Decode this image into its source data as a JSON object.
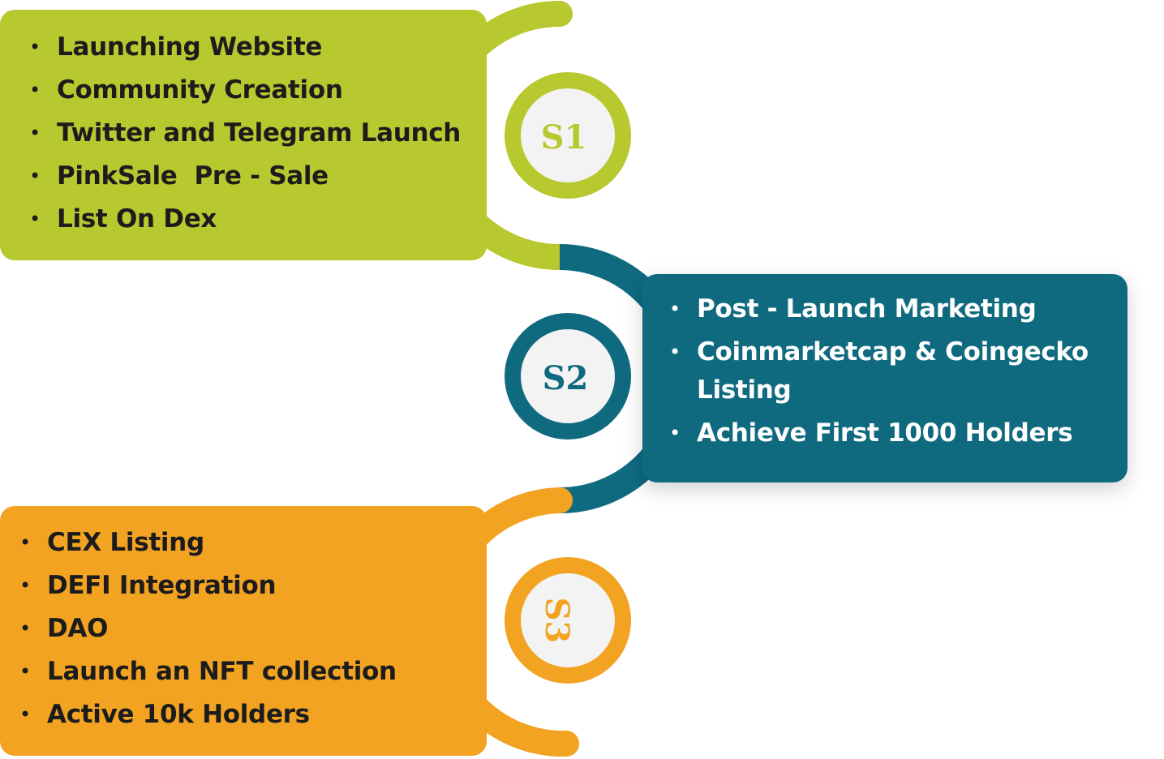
{
  "stages": [
    {
      "badge": "S1",
      "color": "#b8c82f",
      "items": [
        "Launching Website",
        "Community Creation",
        "Twitter and Telegram Launch",
        "PinkSale  Pre - Sale",
        "List On Dex"
      ]
    },
    {
      "badge": "S2",
      "color": "#0f6a80",
      "items": [
        "Post - Launch Marketing",
        "Coinmarketcap & Coingecko Listing",
        "Achieve First 1000 Holders"
      ]
    },
    {
      "badge": "S3",
      "color": "#f2a322",
      "items": [
        "CEX Listing",
        "DEFI Integration",
        "DAO",
        "Launch an NFT collection",
        "Active 10k Holders"
      ]
    }
  ]
}
